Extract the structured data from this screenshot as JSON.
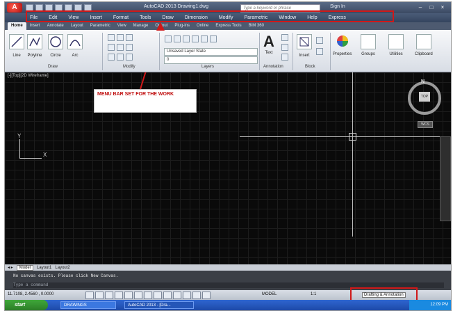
{
  "window": {
    "title": "AutoCAD 2013   Drawing1.dwg",
    "app_button": "A",
    "search_placeholder": "Type a keyword or phrase",
    "sign_in": "Sign In"
  },
  "menubar": [
    "File",
    "Edit",
    "View",
    "Insert",
    "Format",
    "Tools",
    "Draw",
    "Dimension",
    "Modify",
    "Parametric",
    "Window",
    "Help",
    "Express"
  ],
  "ribbon": {
    "tabs": [
      "Home",
      "Insert",
      "Annotate",
      "Layout",
      "Parametric",
      "View",
      "Manage",
      "Output",
      "Plug-ins",
      "Online",
      "Express Tools",
      "BIM 360"
    ],
    "active_tab": "Home",
    "draw_tools": [
      "Line",
      "Polyline",
      "Circle",
      "Arc"
    ],
    "panels": {
      "draw": "Draw",
      "modify": "Modify",
      "layers": "Layers",
      "annotation": "Annotation",
      "block": "Block"
    },
    "layer_state": "Unsaved Layer State",
    "layer_current": "0",
    "big_tools": [
      "Text",
      "Insert",
      "Properties",
      "Groups",
      "Utilities",
      "Clipboard"
    ]
  },
  "canvas": {
    "view_label": "[-][Top][2D Wireframe]",
    "ucs_y": "Y",
    "ucs_x": "X",
    "viewcube_n": "N",
    "viewcube_top": "TOP",
    "wcs": "WCS",
    "callout": "MENU BAR SET FOR THE WORK"
  },
  "layout_tabs": [
    "Model",
    "Layout1",
    "Layout2"
  ],
  "command": {
    "message": "No canvas exists. Please click New Canvas.",
    "prompt": "Type a command"
  },
  "status": {
    "coords": "11.7108, 2.4560 , 0.0000",
    "model": "MODEL",
    "scale": "1:1",
    "workspace": "Drafting & Annotation"
  },
  "taskbar": {
    "start": "start",
    "item1": "DRAWINGS",
    "item2": "AutoCAD 2013 - [Dra...",
    "clock": "12:09 PM"
  },
  "colors": {
    "highlight": "#d01818",
    "canvas": "#0a0a0a",
    "callout_text": "#c01010"
  }
}
